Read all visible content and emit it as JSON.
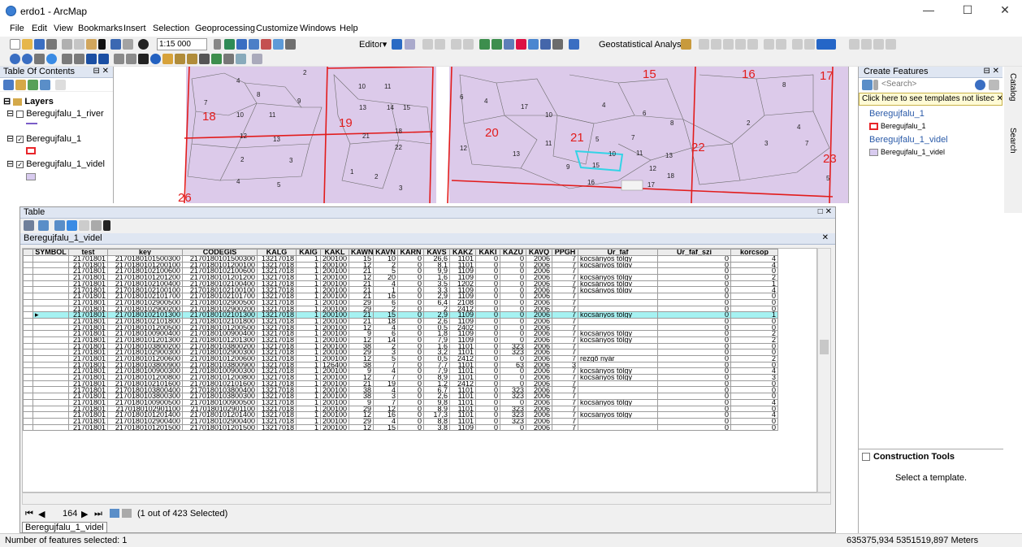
{
  "window": {
    "title": "erdo1 - ArcMap",
    "minimize": "—",
    "maximize": "☐",
    "close": "✕"
  },
  "menu": [
    "File",
    "Edit",
    "View",
    "Bookmarks",
    "Insert",
    "Selection",
    "Geoprocessing",
    "Customize",
    "Windows",
    "Help"
  ],
  "toolbar": {
    "scale": "1:15 000",
    "editor_label": "Editor▾",
    "geostat_label": "Geostatistical Analyst▾"
  },
  "toc": {
    "title": "Table Of Contents",
    "pin": "⊟ ✕",
    "layers_label": "Layers",
    "layers": [
      {
        "name": "Beregujfalu_1_river",
        "checked": false,
        "symbol_color": "#7a5cc8"
      },
      {
        "name": "Beregujfalu_1",
        "checked": true,
        "symbol_color": "#e8252a"
      },
      {
        "name": "Beregujfalu_1_videl",
        "checked": true,
        "symbol_color": "#d8cbef"
      }
    ]
  },
  "map": {
    "parcel_labels": [
      "18",
      "19",
      "20",
      "21",
      "22",
      "23",
      "15",
      "16",
      "17",
      "26"
    ],
    "colors": {
      "fill": "#dccaea",
      "boundary": "#e21c1c",
      "selection": "#33d3e6"
    }
  },
  "table": {
    "title": "Table",
    "window_controls": "□ ✕",
    "layer_tab": "Beregujfalu_1_videl",
    "columns": [
      "SYMBOL",
      "test",
      "key",
      "CODEGIS",
      "KALG",
      "KAIG",
      "KAKL",
      "KAWN",
      "KAVN",
      "KARN",
      "KAVS",
      "KAKZ",
      "KAKI",
      "KAZU",
      "KAVQ",
      "PPGH",
      "Ur_faf",
      "Ur_faf_szi",
      "korcsop"
    ],
    "rows": [
      [
        "",
        "21701801",
        "2170180101500300",
        "2170180101500300",
        "13217018",
        "1",
        "200100",
        "15",
        "10",
        "0",
        "26,6",
        "1101",
        "0",
        "0",
        "2006",
        "7",
        "kocsányos tölgy",
        "0",
        "4"
      ],
      [
        "",
        "21701801",
        "2170180101200100",
        "2170180101200100",
        "13217018",
        "1",
        "200100",
        "12",
        "2",
        "0",
        "8,1",
        "1101",
        "0",
        "0",
        "2006",
        "7",
        "kocsányos tölgy",
        "0",
        "4"
      ],
      [
        "",
        "21701801",
        "2170180102100600",
        "2170180102100600",
        "13217018",
        "1",
        "200100",
        "21",
        "5",
        "0",
        "9,9",
        "1109",
        "0",
        "0",
        "2006",
        "7",
        "",
        "0",
        "0"
      ],
      [
        "",
        "21701801",
        "2170180101201200",
        "2170180101201200",
        "13217018",
        "1",
        "200100",
        "12",
        "20",
        "0",
        "1,6",
        "1109",
        "0",
        "0",
        "2006",
        "7",
        "kocsányos tölgy",
        "0",
        "2"
      ],
      [
        "",
        "21701801",
        "2170180102100400",
        "2170180102100400",
        "13217018",
        "1",
        "200100",
        "21",
        "4",
        "0",
        "3,5",
        "1202",
        "0",
        "0",
        "2006",
        "7",
        "kocsányos tölgy",
        "0",
        "1"
      ],
      [
        "",
        "21701801",
        "2170180102100100",
        "2170180102100100",
        "13217018",
        "1",
        "200100",
        "21",
        "1",
        "0",
        "3,3",
        "1109",
        "0",
        "0",
        "2006",
        "7",
        "kocsányos tölgy",
        "0",
        "4"
      ],
      [
        "",
        "21701801",
        "2170180102101700",
        "2170180102101700",
        "13217018",
        "1",
        "200100",
        "21",
        "16",
        "0",
        "2,9",
        "1109",
        "0",
        "0",
        "2006",
        "7",
        "",
        "0",
        "0"
      ],
      [
        "",
        "21701801",
        "2170180102900500",
        "2170180102900500",
        "13217018",
        "1",
        "200100",
        "29",
        "6",
        "0",
        "6,4",
        "2108",
        "0",
        "0",
        "2006",
        "7",
        "",
        "0",
        "0"
      ],
      [
        "",
        "21701801",
        "2170180102900200",
        "2170180102900200",
        "13217018",
        "1",
        "200100",
        "29",
        "2",
        "0",
        "2",
        "2412",
        "0",
        "0",
        "2006",
        "7",
        "",
        "0",
        "0"
      ],
      [
        "▸",
        "21701801",
        "2170180102101300",
        "2170180102101300",
        "13217018",
        "1",
        "200100",
        "21",
        "15",
        "0",
        "2,9",
        "1109",
        "0",
        "0",
        "2006",
        "7",
        "kocsányos tölgy",
        "0",
        "1"
      ],
      [
        "",
        "21701801",
        "2170180102101800",
        "2170180102101800",
        "13217018",
        "1",
        "200100",
        "21",
        "18",
        "0",
        "2,6",
        "1109",
        "0",
        "0",
        "2006",
        "7",
        "",
        "0",
        "0"
      ],
      [
        "",
        "21701801",
        "2170180101200500",
        "2170180101200500",
        "13217018",
        "1",
        "200100",
        "12",
        "4",
        "0",
        "0,5",
        "2402",
        "0",
        "0",
        "2006",
        "7",
        "",
        "0",
        "0"
      ],
      [
        "",
        "21701801",
        "2170180100900400",
        "2170180100900400",
        "13217018",
        "1",
        "200100",
        "9",
        "6",
        "0",
        "1,8",
        "1109",
        "0",
        "0",
        "2006",
        "7",
        "kocsányos tölgy",
        "0",
        "2"
      ],
      [
        "",
        "21701801",
        "2170180101201300",
        "2170180101201300",
        "13217018",
        "1",
        "200100",
        "12",
        "14",
        "0",
        "7,9",
        "1109",
        "0",
        "0",
        "2006",
        "7",
        "kocsányos tölgy",
        "0",
        "2"
      ],
      [
        "",
        "21701801",
        "2170180103800200",
        "2170180103800200",
        "13217018",
        "1",
        "200100",
        "38",
        "2",
        "0",
        "1,6",
        "1101",
        "0",
        "323",
        "2006",
        "7",
        "",
        "0",
        "0"
      ],
      [
        "",
        "21701801",
        "2170180102900300",
        "2170180102900300",
        "13217018",
        "1",
        "200100",
        "29",
        "3",
        "0",
        "3,2",
        "1101",
        "0",
        "323",
        "2006",
        "7",
        "",
        "0",
        "0"
      ],
      [
        "",
        "21701801",
        "2170180101200600",
        "2170180101200600",
        "13217018",
        "1",
        "200100",
        "12",
        "5",
        "0",
        "0,5",
        "2412",
        "0",
        "0",
        "2006",
        "7",
        "rezgő nyár",
        "0",
        "2"
      ],
      [
        "",
        "21701801",
        "2170180103800900",
        "2170180103800900",
        "13217018",
        "1",
        "126400",
        "38",
        "7",
        "0",
        "7,7",
        "1101",
        "0",
        "63",
        "2006",
        "3",
        "",
        "0",
        "0"
      ],
      [
        "",
        "21701801",
        "2170180100900300",
        "2170180100900300",
        "13217018",
        "1",
        "200100",
        "9",
        "4",
        "0",
        "7,9",
        "1101",
        "0",
        "0",
        "2006",
        "7",
        "kocsányos tölgy",
        "0",
        "4"
      ],
      [
        "",
        "21701801",
        "2170180101200800",
        "2170180101200800",
        "13217018",
        "1",
        "200100",
        "12",
        "7",
        "0",
        "8,9",
        "1101",
        "0",
        "0",
        "2006",
        "7",
        "kocsányos tölgy",
        "0",
        "3"
      ],
      [
        "",
        "21701801",
        "2170180102101600",
        "2170180102101600",
        "13217018",
        "1",
        "200100",
        "21",
        "19",
        "0",
        "1,2",
        "2412",
        "0",
        "0",
        "2006",
        "7",
        "",
        "0",
        "0"
      ],
      [
        "",
        "21701801",
        "2170180103800400",
        "2170180103800400",
        "13217018",
        "1",
        "200100",
        "38",
        "4",
        "0",
        "6,7",
        "1101",
        "0",
        "323",
        "2006",
        "7",
        "",
        "0",
        "0"
      ],
      [
        "",
        "21701801",
        "2170180103800300",
        "2170180103800300",
        "13217018",
        "1",
        "200100",
        "38",
        "3",
        "0",
        "2,6",
        "1101",
        "0",
        "323",
        "2006",
        "7",
        "",
        "0",
        "0"
      ],
      [
        "",
        "21701801",
        "2170180100900500",
        "2170180100900500",
        "13217018",
        "1",
        "200100",
        "9",
        "7",
        "0",
        "9,8",
        "1101",
        "0",
        "0",
        "2006",
        "7",
        "kocsányos tölgy",
        "0",
        "4"
      ],
      [
        "",
        "21701801",
        "2170180102901100",
        "2170180102901100",
        "13217018",
        "1",
        "200100",
        "29",
        "12",
        "0",
        "8,9",
        "1101",
        "0",
        "323",
        "2006",
        "7",
        "",
        "0",
        "0"
      ],
      [
        "",
        "21701801",
        "2170180101201400",
        "2170180101201400",
        "13217018",
        "1",
        "200100",
        "12",
        "16",
        "0",
        "17,3",
        "1101",
        "0",
        "323",
        "2006",
        "7",
        "kocsányos tölgy",
        "0",
        "4"
      ],
      [
        "",
        "21701801",
        "2170180102900400",
        "2170180102900400",
        "13217018",
        "1",
        "200100",
        "29",
        "4",
        "0",
        "8,8",
        "1101",
        "0",
        "323",
        "2006",
        "7",
        "",
        "0",
        "0"
      ],
      [
        "",
        "21701801",
        "2170180101201500",
        "2170180101201500",
        "13217018",
        "1",
        "200100",
        "12",
        "15",
        "0",
        "3,8",
        "1109",
        "0",
        "0",
        "2006",
        "7",
        "",
        "0",
        "0"
      ]
    ],
    "selected_row_index": 9,
    "footer": {
      "nav_first": "⏮",
      "nav_prev": "◀",
      "record": "164",
      "nav_next": "▶",
      "nav_last": "⏭",
      "selection_text": "(1 out of 423 Selected)"
    }
  },
  "create_features": {
    "title": "Create Features",
    "search_placeholder": "<Search>",
    "hint": "Click here to see templates not listec ✕",
    "groups": [
      {
        "header": "Beregujfalu_1",
        "item": "Beregujfalu_1",
        "color": "#e8252a"
      },
      {
        "header": "Beregujfalu_1_videl",
        "item": "Beregujfalu_1_videl",
        "color": "#d8cbef"
      }
    ],
    "construction_title": "Construction Tools",
    "construction_msg": "Select a template."
  },
  "side_tabs": [
    "Catalog",
    "Search"
  ],
  "status": {
    "left": "Number of features selected: 1",
    "right": "635375,934  5351519,897 Meters"
  }
}
